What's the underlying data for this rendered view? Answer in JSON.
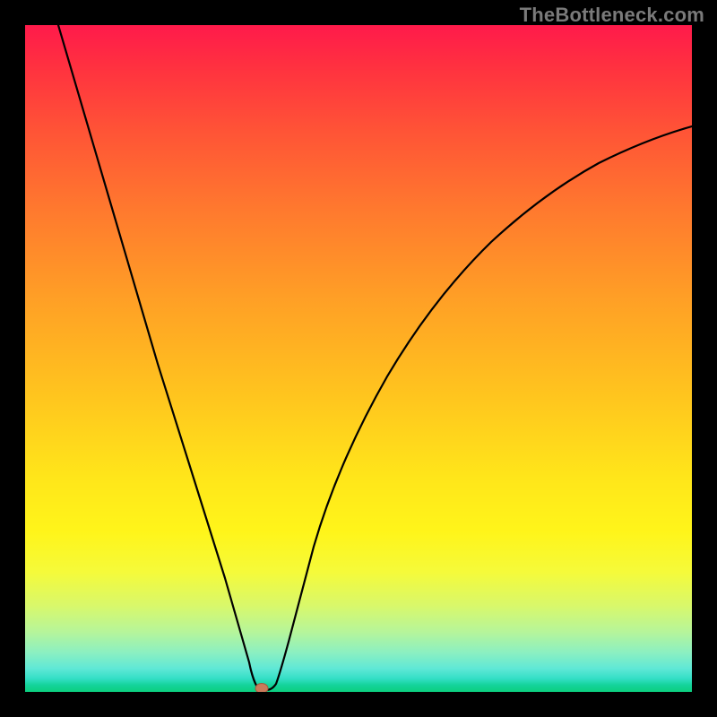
{
  "watermark": "TheBottleneck.com",
  "chart_data": {
    "type": "line",
    "title": "",
    "xlabel": "",
    "ylabel": "",
    "x": [
      0.05,
      0.1,
      0.15,
      0.2,
      0.25,
      0.3,
      0.345,
      0.355,
      0.36,
      0.38,
      0.42,
      0.5,
      0.6,
      0.7,
      0.8,
      0.9,
      1.0
    ],
    "values": [
      1.0,
      0.83,
      0.66,
      0.49,
      0.33,
      0.17,
      0.02,
      0.0,
      0.0,
      0.06,
      0.2,
      0.43,
      0.6,
      0.7,
      0.77,
      0.82,
      0.85
    ],
    "marker": {
      "x": 0.355,
      "y": 0.005
    },
    "xlim": [
      0,
      1
    ],
    "ylim": [
      0,
      1
    ],
    "background": "vertical-gradient-red-to-green",
    "grid": false,
    "legend": false
  }
}
